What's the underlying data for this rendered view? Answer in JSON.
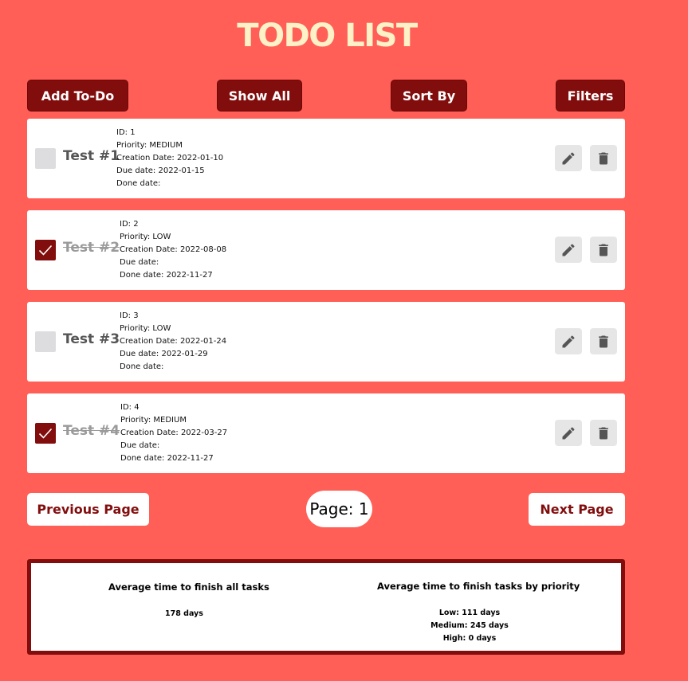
{
  "header": {
    "title": "TODO LIST"
  },
  "toolbar": {
    "add_label": "Add To-Do",
    "show_all_label": "Show All",
    "sort_label": "Sort By",
    "filters_label": "Filters"
  },
  "todos": [
    {
      "title": "Test #1",
      "done": false,
      "id": "ID: 1",
      "priority": "Priority: MEDIUM",
      "creation": "Creation Date: 2022-01-10",
      "due": "Due date: 2022-01-15",
      "done_date": "Done date:"
    },
    {
      "title": "Test #2",
      "done": true,
      "id": "ID: 2",
      "priority": "Priority: LOW",
      "creation": "Creation Date: 2022-08-08",
      "due": "Due date:",
      "done_date": "Done date: 2022-11-27"
    },
    {
      "title": "Test #3",
      "done": false,
      "id": "ID: 3",
      "priority": "Priority: LOW",
      "creation": "Creation Date: 2022-01-24",
      "due": "Due date: 2022-01-29",
      "done_date": "Done date:"
    },
    {
      "title": "Test #4",
      "done": true,
      "id": "ID: 4",
      "priority": "Priority: MEDIUM",
      "creation": "Creation Date: 2022-03-27",
      "due": "Due date:",
      "done_date": "Done date: 2022-11-27"
    }
  ],
  "pagination": {
    "prev_label": "Previous Page",
    "page_label": "Page: 1",
    "next_label": "Next Page"
  },
  "stats": {
    "all_heading": "Average time to finish all tasks",
    "all_value": "178 days",
    "priority_heading": "Average time to finish tasks by priority",
    "low": "Low: 111 days",
    "medium": "Medium: 245 days",
    "high": "High: 0 days"
  },
  "icons": {
    "edit": "pencil-icon",
    "delete": "trash-icon",
    "check": "checkmark-icon"
  },
  "colors": {
    "background": "#ff5f56",
    "accent": "#820d0d",
    "title": "#fdf1c8"
  }
}
